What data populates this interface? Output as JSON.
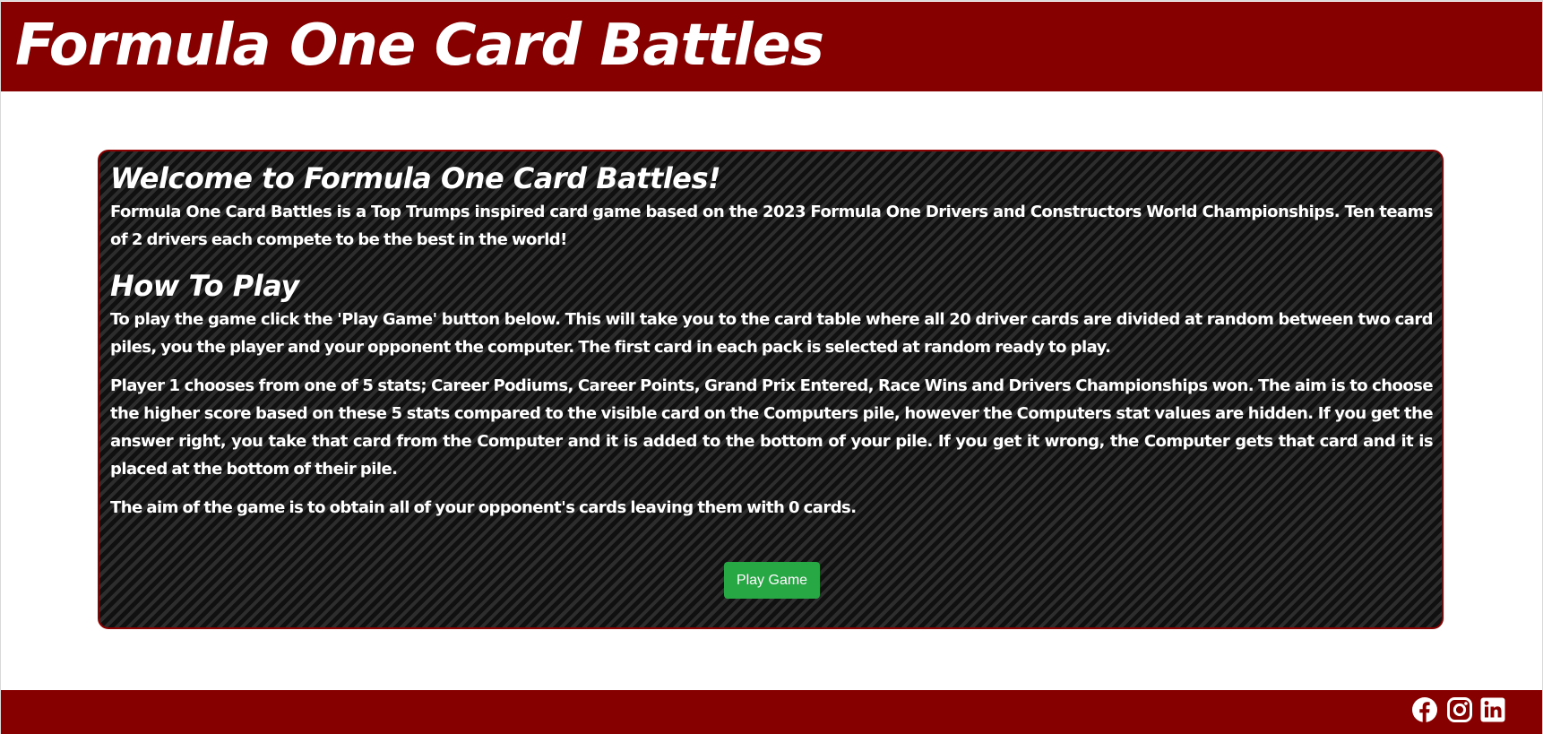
{
  "header": {
    "title": "Formula One Card Battles"
  },
  "main": {
    "welcome_heading": "Welcome to Formula One Card Battles!",
    "intro_text": "Formula One Card Battles is a Top Trumps inspired card game based on the 2023 Formula One Drivers and Constructors World Championships. Ten teams of 2 drivers each compete to be the best in the world!",
    "howto_heading": "How To Play",
    "howto_paragraphs": [
      "To play the game click the 'Play Game' button below. This will take you to the card table where all 20 driver cards are divided at random between two card piles, you the player and your opponent the computer. The first card in each pack is selected at random ready to play.",
      "Player 1 chooses from one of 5 stats; Career Podiums, Career Points, Grand Prix Entered, Race Wins and Drivers Championships won. The aim is to choose the higher score based on these 5 stats compared to the visible card on the Computers pile, however the Computers stat values are hidden. If you get the answer right, you take that card from the Computer and it is added to the bottom of your pile. If you get it wrong, the Computer gets that card and it is placed at the bottom of their pile.",
      "The aim of the game is to obtain all of your opponent's cards leaving them with 0 cards."
    ],
    "play_button_label": "Play Game"
  },
  "footer": {
    "social_icons": [
      "facebook-icon",
      "instagram-icon",
      "linkedin-icon"
    ]
  },
  "colors": {
    "brand_red": "#870000",
    "button_green": "#28a745",
    "panel_dark": "#151515"
  }
}
